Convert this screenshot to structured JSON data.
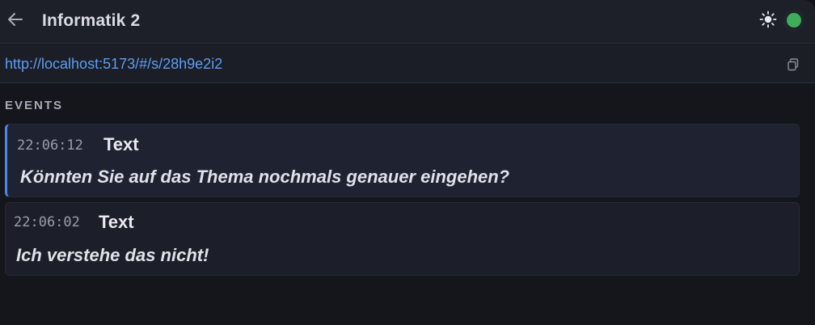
{
  "header": {
    "title": "Informatik 2",
    "status_color": "#3fae5a"
  },
  "urlbar": {
    "url": "http://localhost:5173/#/s/28h9e2i2"
  },
  "events": {
    "heading": "EVENTS",
    "items": [
      {
        "time": "22:06:12",
        "type": "Text",
        "message": "Könnten Sie auf das Thema nochmals genauer eingehen?"
      },
      {
        "time": "22:06:02",
        "type": "Text",
        "message": "Ich verstehe das nicht!"
      }
    ]
  },
  "colors": {
    "accent": "#4d86ee",
    "link": "#5f9cf0"
  }
}
